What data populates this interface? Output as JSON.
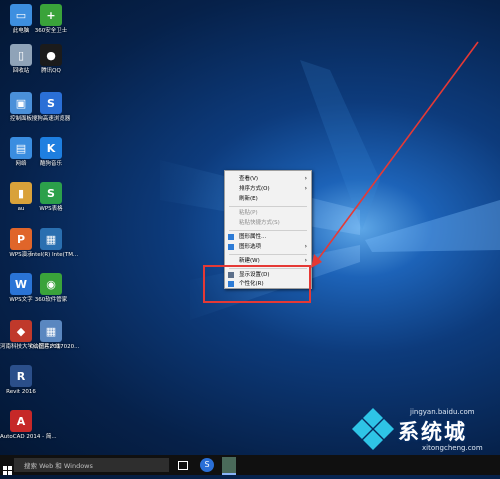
{
  "desktop_icons": [
    {
      "label": "此电脑",
      "color": "#3d8fe0",
      "glyph": "▭"
    },
    {
      "label": "360安全卫士",
      "color": "#3aa33a",
      "glyph": "+"
    },
    {
      "label": "回收站",
      "color": "#8fa3b8",
      "glyph": "▯"
    },
    {
      "label": "腾讯QQ",
      "color": "#1b1b1b",
      "glyph": "●"
    },
    {
      "label": "控制面板",
      "color": "#4a90d9",
      "glyph": "▣"
    },
    {
      "label": "搜狗高速浏览器",
      "color": "#2a6fd6",
      "glyph": "S"
    },
    {
      "label": "网络",
      "color": "#3a8de0",
      "glyph": "▤"
    },
    {
      "label": "酷狗音乐",
      "color": "#1e7fe0",
      "glyph": "K"
    },
    {
      "label": "au",
      "color": "#d9a23a",
      "glyph": "▮"
    },
    {
      "label": "WPS表格",
      "color": "#2ca04b",
      "glyph": "S"
    },
    {
      "label": "WPS演示",
      "color": "#e0652a",
      "glyph": "P"
    },
    {
      "label": "Intel(R) Inte(TM...",
      "color": "#2a6fb0",
      "glyph": "▦"
    },
    {
      "label": "WPS文字",
      "color": "#2a74d6",
      "glyph": "W"
    },
    {
      "label": "360软件管家",
      "color": "#3aa33a",
      "glyph": "◉"
    },
    {
      "label": "河南科技大学认证客户端",
      "color": "#c0392b",
      "glyph": "◆"
    },
    {
      "label": "QQ图片2017020...",
      "color": "#5a87c0",
      "glyph": "▦"
    },
    {
      "label": "Revit 2016",
      "color": "#2b4f8a",
      "glyph": "R"
    },
    {
      "label": "AutoCAD 2014 - 简...",
      "color": "#c62828",
      "glyph": "A"
    }
  ],
  "context_menu": {
    "items": [
      {
        "label": "查看(V)",
        "disabled": false,
        "submenu": true
      },
      {
        "label": "排序方式(O)",
        "disabled": false,
        "submenu": true
      },
      {
        "label": "刷新(E)",
        "disabled": false,
        "submenu": false
      },
      {
        "label": "粘贴(P)",
        "disabled": true,
        "submenu": false
      },
      {
        "label": "粘贴快捷方式(S)",
        "disabled": true,
        "submenu": false
      },
      {
        "label": "图形属性...",
        "disabled": false,
        "submenu": false
      },
      {
        "label": "图形选项",
        "disabled": false,
        "submenu": true
      },
      {
        "label": "新建(W)",
        "disabled": false,
        "submenu": true
      },
      {
        "label": "显示设置(D)",
        "disabled": false,
        "submenu": false
      },
      {
        "label": "个性化(R)",
        "disabled": false,
        "submenu": false
      }
    ]
  },
  "taskbar": {
    "search_placeholder": "搜索 Web 和 Windows"
  },
  "watermark": {
    "site_upper": "jingyan.baidu.com",
    "brand": "系统城",
    "site_lower": "xitongcheng.com"
  },
  "colors": {
    "highlight": "#e53935"
  }
}
